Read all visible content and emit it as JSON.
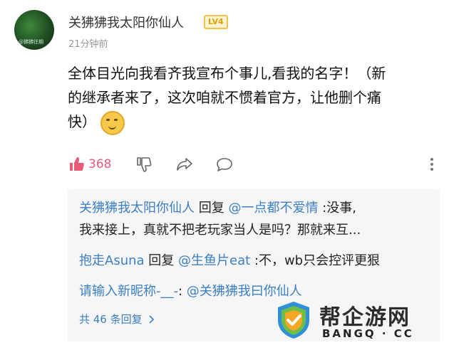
{
  "user": {
    "name": "关狒狒我太阳你仙人",
    "level": "LV4",
    "avatar_text": "@狒狒往期",
    "time": "21分钟前"
  },
  "comment": {
    "line1": "全体目光向我看齐我宣布个事儿,看我的名字！（新",
    "line2": "的继承者来了，这次咱就不惯着官方，让他删个痛",
    "line3": "快）"
  },
  "actions": {
    "like_count": "368",
    "icons": [
      "thumb-up-icon",
      "thumb-down-icon",
      "share-icon",
      "comment-icon",
      "more-icon"
    ]
  },
  "replies": [
    {
      "user": "关狒狒我太阳你仙人",
      "verb": " 回复 ",
      "target": "@一点都不爱情",
      "text1": " :没事,",
      "text2": "我来接上，真就不把老玩家当人是吗？那就来互..."
    },
    {
      "user": "抱走Asuna",
      "verb": " 回复 ",
      "target": "@生鱼片eat",
      "text1": " :不，wb只会控评更狠"
    },
    {
      "user": "请输入新昵称-__-",
      "text1": ": ",
      "target": "@关狒狒我曰你仙人"
    }
  ],
  "more_replies": "共 46 条回复",
  "watermark": {
    "name": "帮企游网",
    "sub": "BANGQ · CC"
  },
  "colors": {
    "link_blue": "#3b7fc4",
    "like_pink": "#e8597a",
    "level_gold": "#e4a200"
  }
}
